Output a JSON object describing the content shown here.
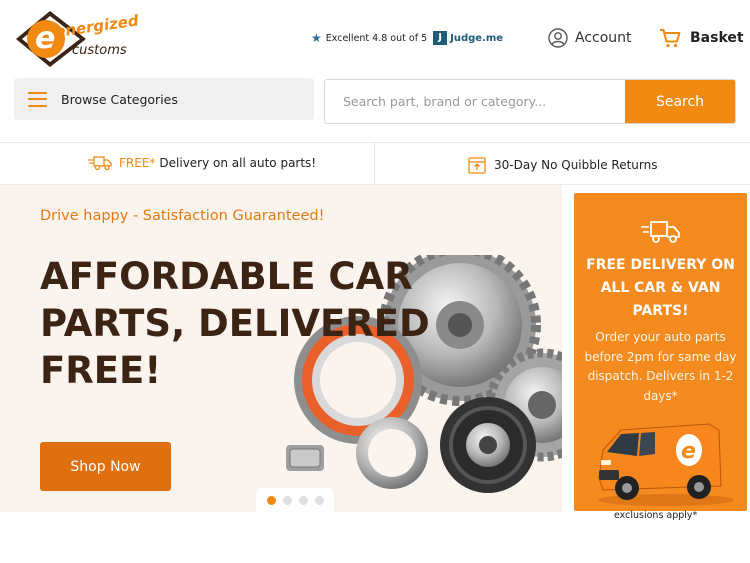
{
  "brand": {
    "logo_text_top": "energized",
    "logo_text_bottom": "customs",
    "colors": {
      "accent": "#f28a12",
      "dark_brown": "#3c2415",
      "promo_bg": "#f58a1f",
      "hero_bg": "#fbf3ee"
    }
  },
  "header": {
    "rating_text": "Excellent 4.8 out of 5",
    "rating_badge": "J",
    "rating_provider": "Judge.me",
    "account_label": "Account",
    "basket_label": "Basket",
    "account_icon": "user-circle-icon",
    "basket_icon": "cart-icon"
  },
  "search": {
    "browse_label": "Browse Categories",
    "placeholder": "Search part, brand or category...",
    "value": "",
    "button_label": "Search"
  },
  "usp": {
    "delivery_free": "FREE*",
    "delivery_text": "Delivery on all auto parts!",
    "returns_text": "30-Day No Quibble Returns",
    "delivery_icon": "truck-icon",
    "returns_icon": "return-box-icon"
  },
  "hero": {
    "tagline": "Drive happy - Satisfaction Guaranteed!",
    "title_line1": "AFFORDABLE CAR",
    "title_line2": "PARTS, DELIVERED",
    "title_line3": "FREE!",
    "cta_label": "Shop Now",
    "slides_total": 4,
    "active_slide": 1
  },
  "promo": {
    "title": "FREE DELIVERY ON ALL CAR & VAN PARTS!",
    "text": "Order your auto parts before 2pm for same day dispatch. Delivers in 1-2 days*",
    "footnote": "exclusions apply*",
    "truck_icon": "truck-icon",
    "van_badge": "e"
  }
}
